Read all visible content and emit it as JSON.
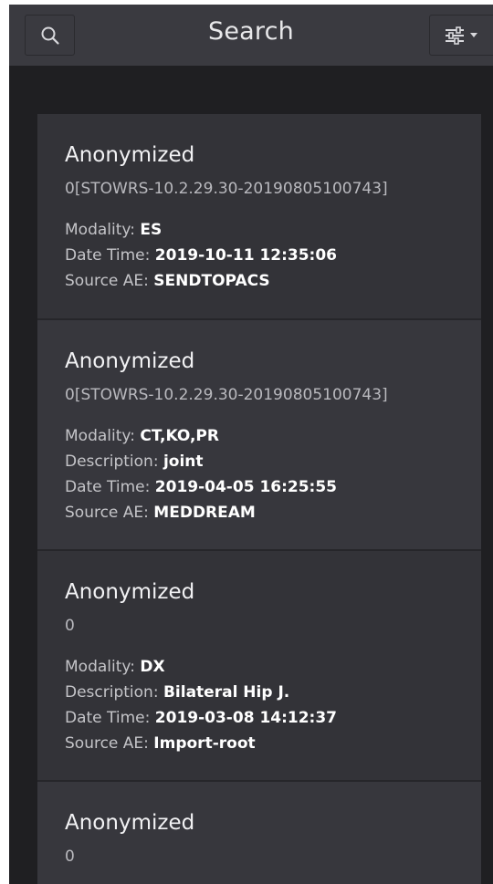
{
  "header": {
    "title": "Search",
    "search_icon": "search-icon",
    "filter_icon": "sliders-icon"
  },
  "colors": {
    "background": "#1f1f22",
    "header": "#3a3a40",
    "card": "#333338",
    "text": "#ffffff",
    "muted_text": "#b9b9be"
  },
  "studies": [
    {
      "name": "Anonymized",
      "id": "0[STOWRS-10.2.29.30-20190805100743]",
      "modality_label": "Modality:",
      "modality": "ES",
      "datetime_label": "Date Time:",
      "datetime": "2019-10-11 12:35:06",
      "source_label": "Source AE:",
      "source": "SENDTOPACS"
    },
    {
      "name": "Anonymized",
      "id": "0[STOWRS-10.2.29.30-20190805100743]",
      "modality_label": "Modality:",
      "modality": "CT,KO,PR",
      "description_label": "Description:",
      "description": "joint",
      "datetime_label": "Date Time:",
      "datetime": "2019-04-05 16:25:55",
      "source_label": "Source AE:",
      "source": "MEDDREAM"
    },
    {
      "name": "Anonymized",
      "id": "0",
      "modality_label": "Modality:",
      "modality": "DX",
      "description_label": "Description:",
      "description": "Bilateral Hip J.",
      "datetime_label": "Date Time:",
      "datetime": "2019-03-08 14:12:37",
      "source_label": "Source AE:",
      "source": "Import-root"
    },
    {
      "name": "Anonymized",
      "id": "0"
    }
  ]
}
